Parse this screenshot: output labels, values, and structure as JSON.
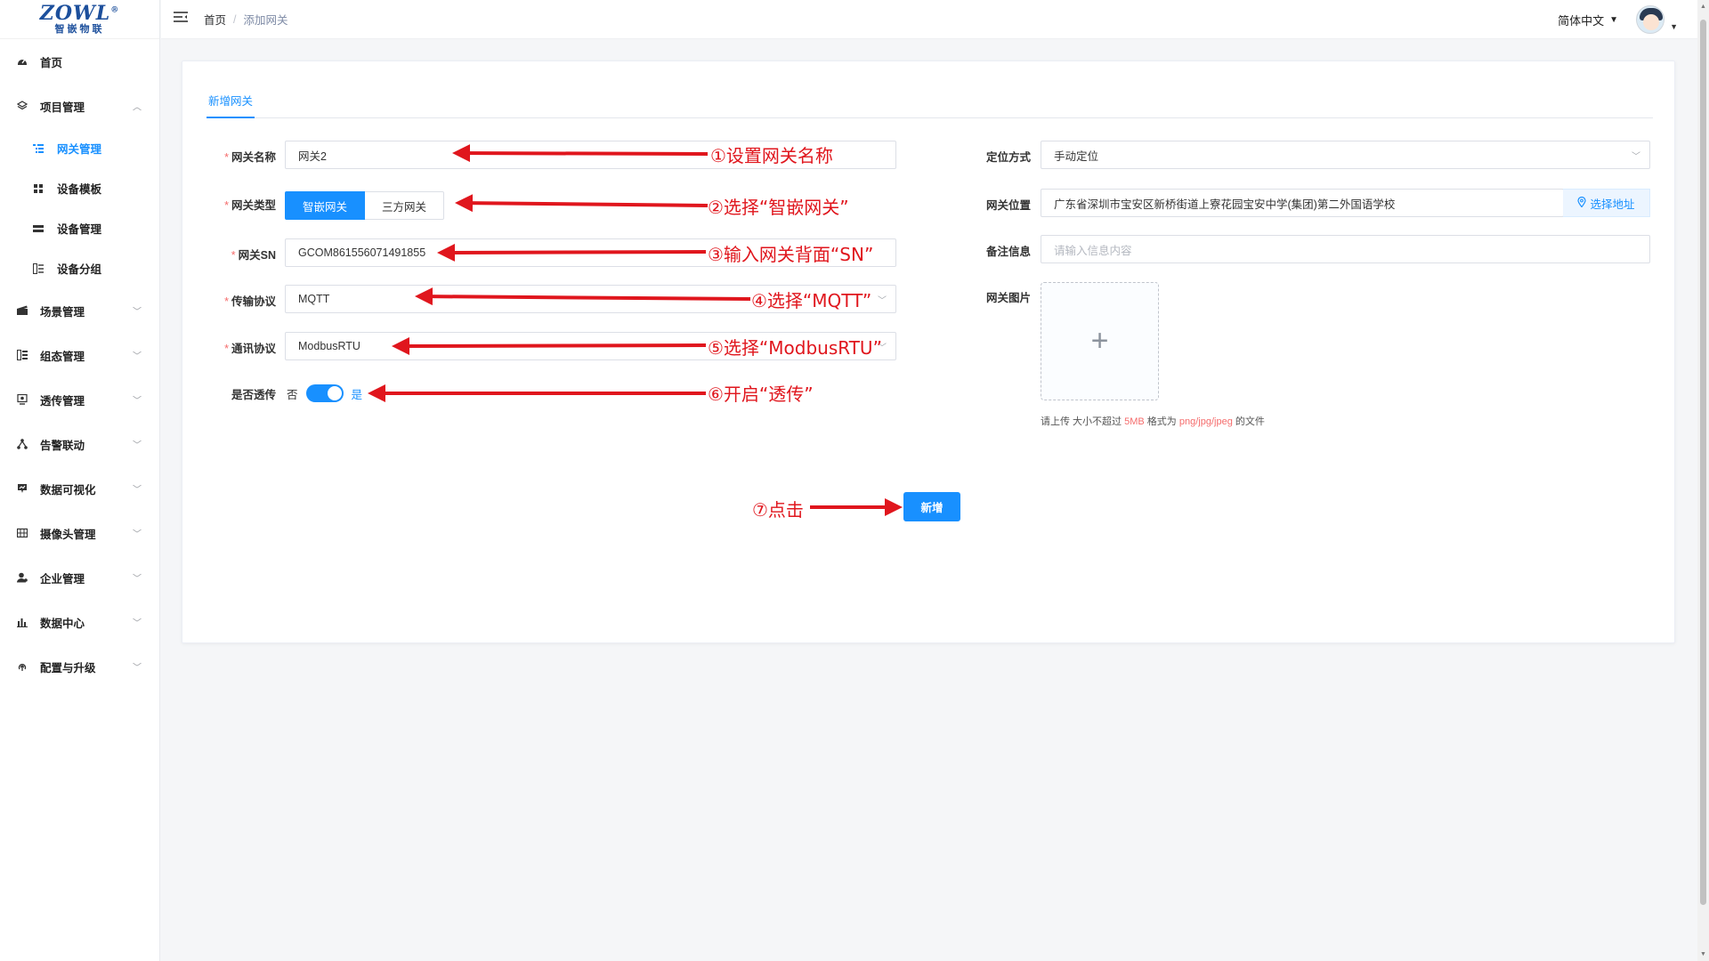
{
  "brand": {
    "logo_top": "ZOWL",
    "logo_mark": "®",
    "logo_bottom": "智嵌物联"
  },
  "header": {
    "breadcrumb": [
      {
        "label": "首页"
      },
      {
        "label": "添加网关"
      }
    ],
    "breadcrumb_sep": "/",
    "language": "简体中文"
  },
  "sidebar": {
    "items": [
      {
        "label": "首页",
        "icon": "dashboard-icon"
      },
      {
        "label": "项目管理",
        "icon": "layers-icon",
        "expanded": true,
        "children": [
          {
            "label": "网关管理",
            "icon": "gateway-list-icon",
            "active": true
          },
          {
            "label": "设备模板",
            "icon": "grid-icon"
          },
          {
            "label": "设备管理",
            "icon": "device-icon"
          },
          {
            "label": "设备分组",
            "icon": "group-icon"
          }
        ]
      },
      {
        "label": "场景管理",
        "icon": "scene-icon"
      },
      {
        "label": "组态管理",
        "icon": "config-icon"
      },
      {
        "label": "透传管理",
        "icon": "passthrough-icon"
      },
      {
        "label": "告警联动",
        "icon": "alarm-link-icon"
      },
      {
        "label": "数据可视化",
        "icon": "visual-icon"
      },
      {
        "label": "摄像头管理",
        "icon": "camera-icon"
      },
      {
        "label": "企业管理",
        "icon": "company-icon"
      },
      {
        "label": "数据中心",
        "icon": "data-center-icon"
      },
      {
        "label": "配置与升级",
        "icon": "upgrade-icon"
      }
    ]
  },
  "form": {
    "tab": "新增网关",
    "name": {
      "label": "网关名称",
      "value": "网关2"
    },
    "type": {
      "label": "网关类型",
      "options": [
        "智嵌网关",
        "三方网关"
      ],
      "selected": "智嵌网关"
    },
    "sn": {
      "label": "网关SN",
      "value": "GCOM861556071491855"
    },
    "transport": {
      "label": "传输协议",
      "value": "MQTT"
    },
    "comm": {
      "label": "通讯协议",
      "value": "ModbusRTU"
    },
    "passthrough": {
      "label": "是否透传",
      "off_label": "否",
      "on_label": "是",
      "on": true
    },
    "locate": {
      "label": "定位方式",
      "value": "手动定位"
    },
    "location": {
      "label": "网关位置",
      "value": "广东省深圳市宝安区新桥街道上寮花园宝安中学(集团)第二外国语学校",
      "button": "选择地址"
    },
    "remark": {
      "label": "备注信息",
      "placeholder": "请输入信息内容"
    },
    "image": {
      "label": "网关图片",
      "tip_1": "请上传 大小不超过 ",
      "tip_size": "5MB",
      "tip_2": " 格式为 ",
      "tip_formats": "png/jpg/jpeg",
      "tip_3": " 的文件"
    },
    "submit": "新增"
  },
  "annotations": [
    "①设置网关名称",
    "②选择“智嵌网关”",
    "③输入网关背面“SN”",
    "④选择“MQTT”",
    "⑤选择“ModbusRTU”",
    "⑥开启“透传”",
    "⑦点击"
  ],
  "colors": {
    "primary": "#1890ff",
    "annotation": "#e0161d",
    "required": "#f56c6c"
  }
}
